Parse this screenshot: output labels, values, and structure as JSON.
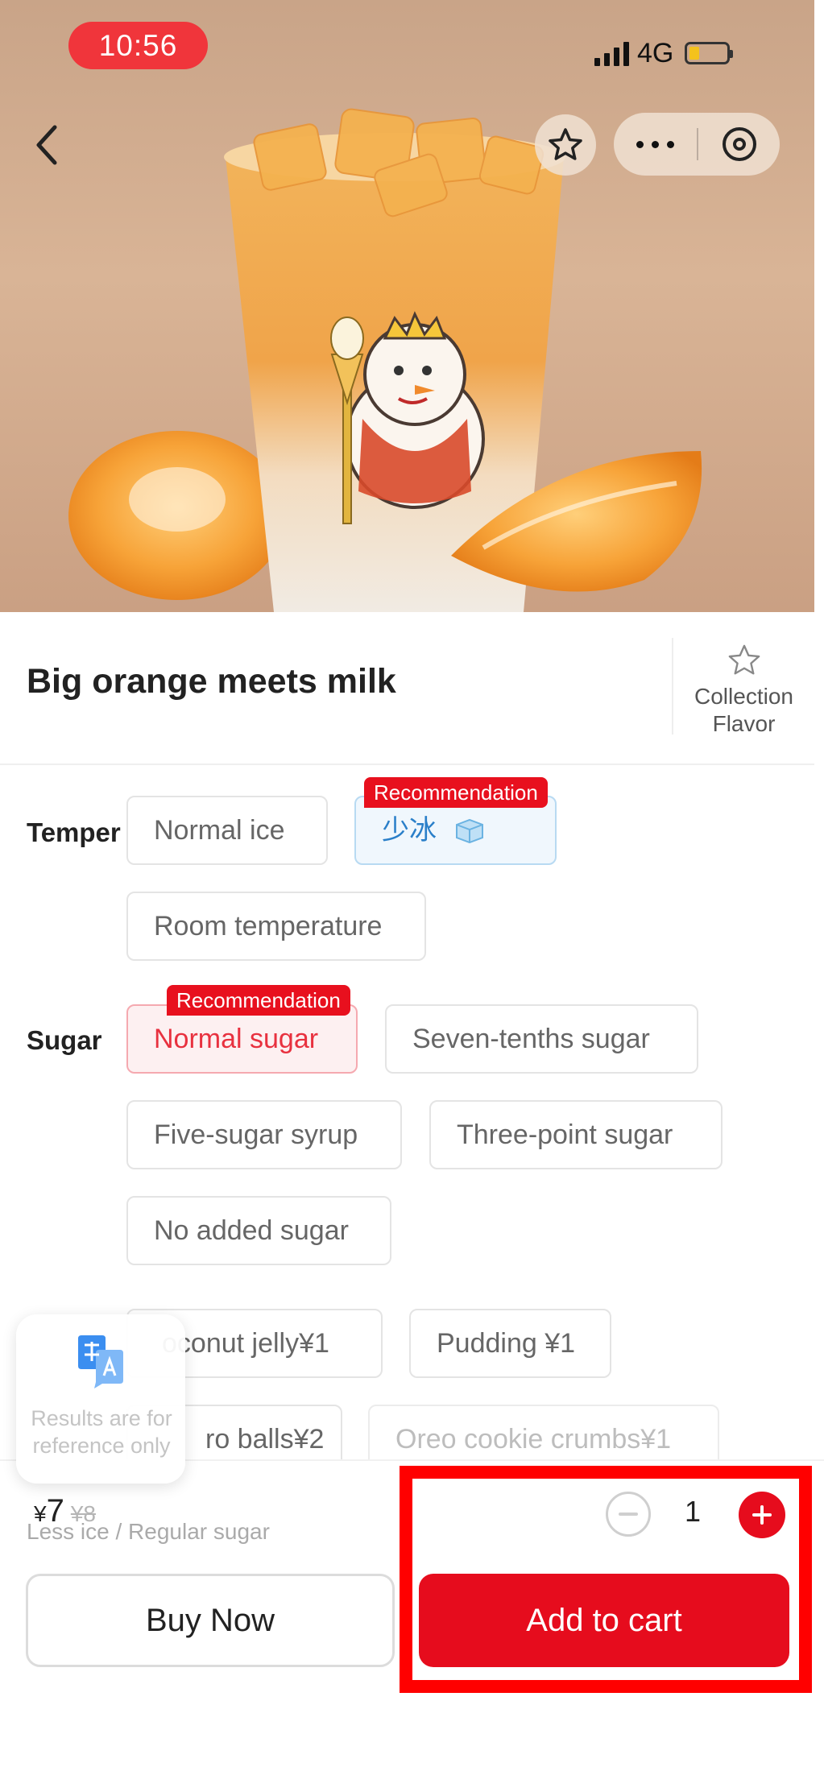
{
  "status_bar": {
    "time": "10:56",
    "network": "4G",
    "signal_icon": "signal-bars-icon",
    "battery_icon": "battery-low-icon"
  },
  "navigation": {
    "back_icon": "chevron-left-icon",
    "favorite_icon": "star-icon",
    "more_icon": "more-dots-icon",
    "close_icon": "close-circle-icon"
  },
  "product": {
    "title": "Big orange meets milk",
    "collect_label_1": "Collection",
    "collect_label_2": "Flavor"
  },
  "options": {
    "temperature": {
      "label": "Temper",
      "recommendation_badge": "Recommendation",
      "choices": [
        "Normal ice",
        "少冰",
        "Room temperature"
      ],
      "selected": "少冰"
    },
    "sugar": {
      "label": "Sugar",
      "recommendation_badge": "Recommendation",
      "choices": [
        "Normal sugar",
        "Seven-tenths sugar",
        "Five-sugar syrup",
        "Three-point sugar",
        "No added sugar"
      ],
      "selected": "Normal sugar"
    },
    "toppings": {
      "choices": [
        "oconut jelly¥1",
        "Pudding ¥1",
        "ro balls¥2",
        "Oreo cookie crumbs¥1"
      ]
    }
  },
  "translate_float": {
    "icon": "translate-icon",
    "text": "Results are for reference only"
  },
  "order": {
    "currency": "¥",
    "price": "7",
    "original_price": "¥8",
    "spec_summary": "Less ice / Regular sugar",
    "quantity": "1",
    "minus_icon": "minus-circle-icon",
    "plus_icon": "plus-circle-icon",
    "buy_now_label": "Buy Now",
    "add_to_cart_label": "Add to cart"
  },
  "colors": {
    "accent_red": "#e60c1d",
    "badge_red": "#e8101e",
    "selected_blue": "#2a7fc9",
    "status_time_bg": "#f0353b",
    "highlight": "#ff0000"
  }
}
